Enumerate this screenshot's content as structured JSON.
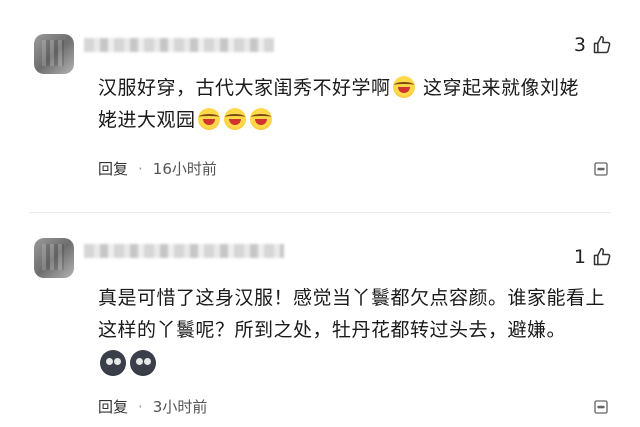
{
  "comments": [
    {
      "likes": "3",
      "text_1": "汉服好穿，古代大家闺秀不好学啊",
      "text_2": " 这穿起来就像刘姥",
      "text_3": "姥进大观园",
      "reply_label": "回复",
      "separator": "·",
      "time": "16小时前",
      "emoji": "laugh-emoji"
    },
    {
      "likes": "1",
      "text_1": "真是可惜了这身汉服！感觉当丫鬟都欠点容颜。谁家能看上这样的丫鬟呢？所到之处，牡丹花都转过头去，避嫌。",
      "reply_label": "回复",
      "separator": "·",
      "time": "3小时前",
      "emoji": "dark-face-emoji"
    }
  ],
  "icons": {
    "thumb": "thumbs-up-icon",
    "more": "more-icon"
  }
}
